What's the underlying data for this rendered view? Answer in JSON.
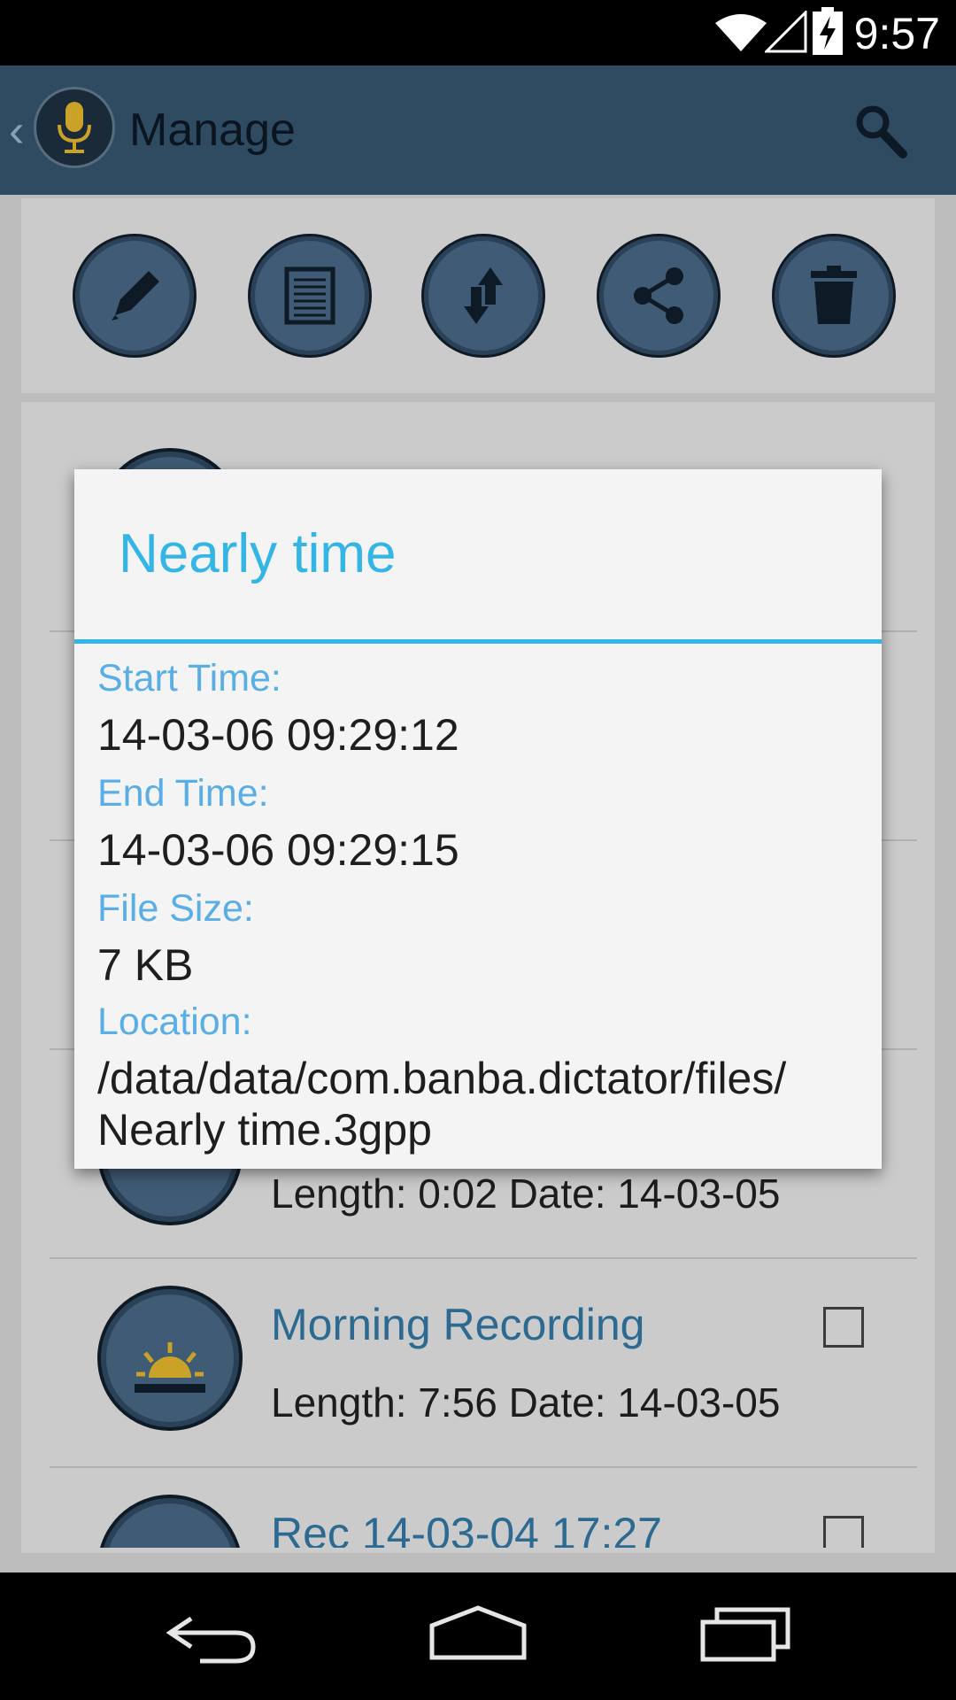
{
  "status_bar": {
    "time": "9:57"
  },
  "action_bar": {
    "title": "Manage"
  },
  "toolbar": {
    "items": [
      "edit-icon",
      "notes-icon",
      "sort-icon",
      "share-icon",
      "trash-icon"
    ]
  },
  "list": {
    "items": [
      {
        "meta": "Length: 0:02 Date: 14-03-05"
      },
      {
        "title": "Morning Recording",
        "meta": "Length: 7:56 Date: 14-03-05"
      },
      {
        "title": "Rec 14-03-04 17:27"
      }
    ]
  },
  "dialog": {
    "title": "Nearly time",
    "start_label": "Start Time:",
    "start_value": "14-03-06 09:29:12",
    "end_label": "End Time:",
    "end_value": "14-03-06 09:29:15",
    "size_label": "File Size:",
    "size_value": "7 KB",
    "location_label": "Location:",
    "location_line1": "/data/data/com.banba.dictator/files/",
    "location_line2": "Nearly time.3gpp"
  }
}
